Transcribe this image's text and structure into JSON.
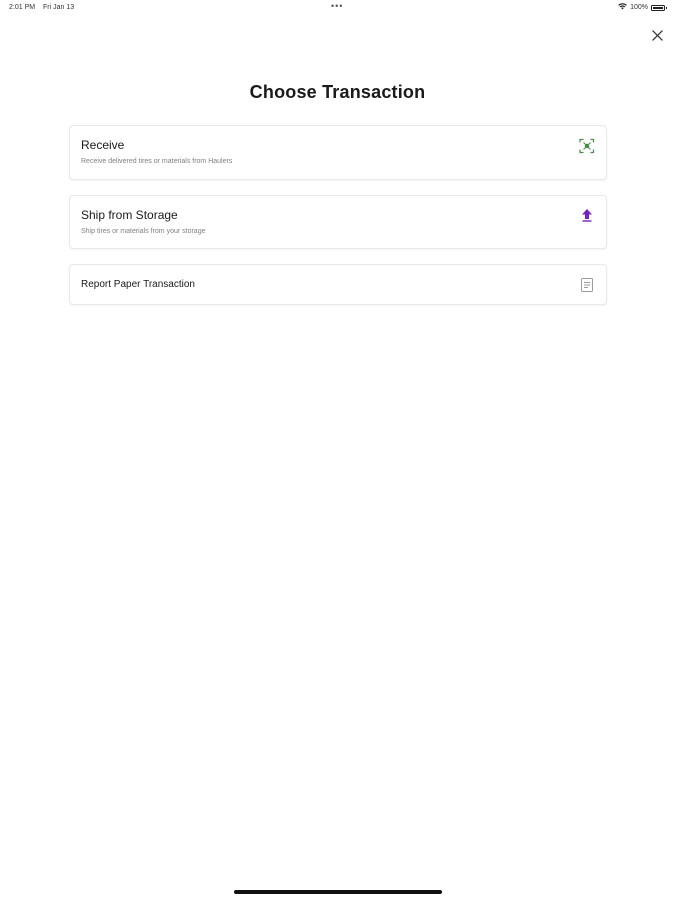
{
  "status_bar": {
    "time": "2:01 PM",
    "date": "Fri Jan 13",
    "dots": "•••",
    "battery_percent": "100%",
    "battery_level": 1.0
  },
  "header": {
    "title": "Choose Transaction",
    "close_icon": "close-icon"
  },
  "options": [
    {
      "title": "Receive",
      "subtitle": "Receive delivered tires or materials from Haulers",
      "icon": "scan-icon",
      "icon_color": "#4a8a4a"
    },
    {
      "title": "Ship from Storage",
      "subtitle": "Ship tires or materials from your storage",
      "icon": "upload-icon",
      "icon_color": "#7a22b8"
    },
    {
      "title": "Report Paper Transaction",
      "icon": "document-icon",
      "icon_color": "#9a9a9a"
    }
  ]
}
